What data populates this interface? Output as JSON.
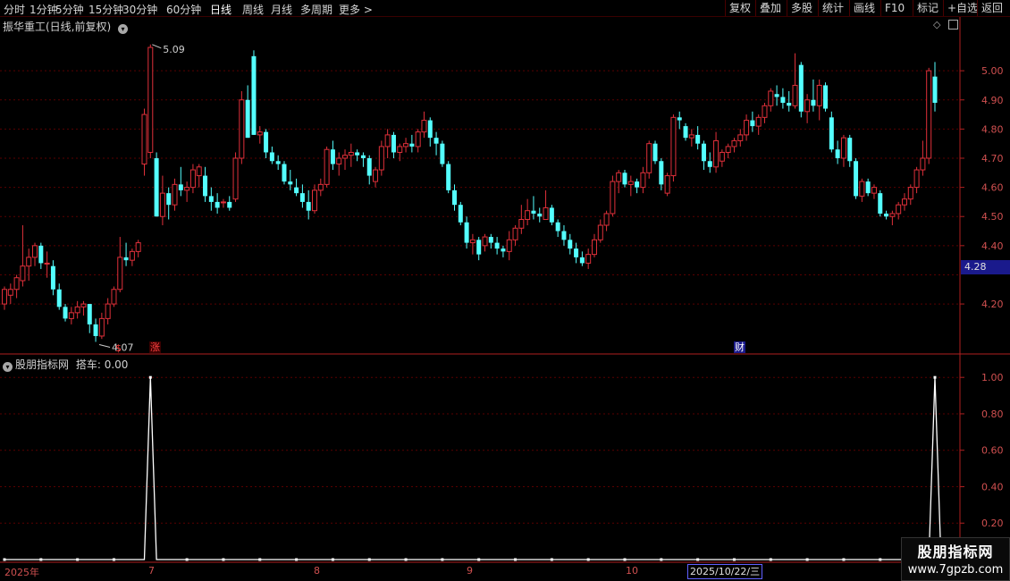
{
  "toolbar": {
    "periods": [
      "分时",
      "1分钟",
      "5分钟",
      "15分钟",
      "30分钟",
      "60分钟",
      "日线",
      "周线",
      "月线",
      "多周期",
      "更多 >"
    ],
    "active": "日线",
    "right_buttons": [
      "复权",
      "叠加",
      "多股",
      "统计",
      "画线",
      "F10",
      "标记",
      "+自选",
      "返回"
    ]
  },
  "main_panel": {
    "title": "振华重工(日线,前复权)",
    "high_label": "5.09",
    "low_label": "4.07",
    "current_price": "4.28",
    "yaxis_ticks": [
      "5.00",
      "4.90",
      "4.80",
      "4.70",
      "4.60",
      "4.50",
      "4.40",
      "4.20"
    ],
    "markers": [
      {
        "text": "$",
        "color": "#ff4040"
      },
      {
        "text": "涨",
        "color": "#ff4040"
      },
      {
        "text": "财",
        "color": "#ffffff"
      }
    ]
  },
  "indicator_panel": {
    "title": "股朋指标网",
    "value_label": "搭车: 0.00",
    "yaxis_ticks": [
      "1.00",
      "0.80",
      "0.60",
      "0.40",
      "0.20"
    ]
  },
  "time_axis": {
    "labels": [
      "2025年",
      "7",
      "8",
      "9",
      "10"
    ],
    "cursor_date": "2025/10/22/三"
  },
  "watermark": {
    "title": "股朋指标网",
    "url": "www.7gpzb.com"
  },
  "colors": {
    "up": "#e0303a",
    "down": "#54ffff",
    "grid": "#5a0000",
    "axis": "#b02020",
    "indicator_line": "#ffffff"
  },
  "chart_data": [
    {
      "type": "candlestick",
      "title": "振华重工(日线,前复权)",
      "ylim": [
        4.05,
        5.12
      ],
      "candles": [
        [
          4.2,
          4.26,
          4.18,
          4.25
        ],
        [
          4.23,
          4.27,
          4.2,
          4.25
        ],
        [
          4.25,
          4.3,
          4.22,
          4.29
        ],
        [
          4.28,
          4.47,
          4.26,
          4.33
        ],
        [
          4.33,
          4.39,
          4.28,
          4.36
        ],
        [
          4.36,
          4.41,
          4.33,
          4.4
        ],
        [
          4.4,
          4.41,
          4.32,
          4.34
        ],
        [
          4.34,
          4.38,
          4.29,
          4.34
        ],
        [
          4.33,
          4.35,
          4.23,
          4.25
        ],
        [
          4.25,
          4.27,
          4.18,
          4.19
        ],
        [
          4.19,
          4.2,
          4.14,
          4.15
        ],
        [
          4.15,
          4.19,
          4.13,
          4.17
        ],
        [
          4.17,
          4.21,
          4.15,
          4.19
        ],
        [
          4.19,
          4.21,
          4.16,
          4.2
        ],
        [
          4.2,
          4.2,
          4.1,
          4.13
        ],
        [
          4.13,
          4.15,
          4.07,
          4.09
        ],
        [
          4.09,
          4.17,
          4.08,
          4.15
        ],
        [
          4.15,
          4.22,
          4.13,
          4.2
        ],
        [
          4.2,
          4.26,
          4.19,
          4.25
        ],
        [
          4.25,
          4.43,
          4.24,
          4.36
        ],
        [
          4.36,
          4.41,
          4.33,
          4.35
        ],
        [
          4.35,
          4.39,
          4.33,
          4.38
        ],
        [
          4.38,
          4.42,
          4.36,
          4.41
        ],
        [
          4.68,
          4.87,
          4.64,
          4.85
        ],
        [
          4.72,
          5.09,
          4.7,
          5.08
        ],
        [
          4.7,
          4.72,
          4.5,
          4.5
        ],
        [
          4.5,
          4.64,
          4.47,
          4.58
        ],
        [
          4.58,
          4.6,
          4.49,
          4.54
        ],
        [
          4.54,
          4.63,
          4.52,
          4.61
        ],
        [
          4.61,
          4.67,
          4.57,
          4.59
        ],
        [
          4.59,
          4.62,
          4.55,
          4.6
        ],
        [
          4.6,
          4.68,
          4.58,
          4.66
        ],
        [
          4.64,
          4.68,
          4.6,
          4.67
        ],
        [
          4.64,
          4.67,
          4.55,
          4.57
        ],
        [
          4.57,
          4.6,
          4.52,
          4.55
        ],
        [
          4.55,
          4.58,
          4.51,
          4.53
        ],
        [
          4.55,
          4.56,
          4.53,
          4.55
        ],
        [
          4.55,
          4.57,
          4.52,
          4.53
        ],
        [
          4.56,
          4.72,
          4.55,
          4.7
        ],
        [
          4.7,
          4.93,
          4.68,
          4.9
        ],
        [
          4.9,
          4.95,
          4.77,
          4.77
        ],
        [
          5.05,
          5.07,
          4.78,
          4.78
        ],
        [
          4.78,
          4.81,
          4.75,
          4.79
        ],
        [
          4.79,
          4.8,
          4.7,
          4.72
        ],
        [
          4.72,
          4.74,
          4.68,
          4.69
        ],
        [
          4.69,
          4.71,
          4.66,
          4.68
        ],
        [
          4.68,
          4.69,
          4.61,
          4.62
        ],
        [
          4.62,
          4.66,
          4.59,
          4.61
        ],
        [
          4.6,
          4.63,
          4.57,
          4.58
        ],
        [
          4.58,
          4.61,
          4.53,
          4.55
        ],
        [
          4.55,
          4.59,
          4.49,
          4.52
        ],
        [
          4.52,
          4.61,
          4.51,
          4.59
        ],
        [
          4.59,
          4.63,
          4.57,
          4.61
        ],
        [
          4.61,
          4.74,
          4.6,
          4.73
        ],
        [
          4.73,
          4.76,
          4.66,
          4.68
        ],
        [
          4.68,
          4.72,
          4.64,
          4.7
        ],
        [
          4.7,
          4.73,
          4.66,
          4.71
        ],
        [
          4.71,
          4.75,
          4.67,
          4.72
        ],
        [
          4.72,
          4.73,
          4.69,
          4.71
        ],
        [
          4.71,
          4.72,
          4.67,
          4.7
        ],
        [
          4.7,
          4.71,
          4.61,
          4.64
        ],
        [
          4.62,
          4.67,
          4.6,
          4.66
        ],
        [
          4.66,
          4.76,
          4.64,
          4.74
        ],
        [
          4.74,
          4.8,
          4.7,
          4.78
        ],
        [
          4.78,
          4.79,
          4.7,
          4.72
        ],
        [
          4.72,
          4.75,
          4.69,
          4.74
        ],
        [
          4.74,
          4.77,
          4.72,
          4.75
        ],
        [
          4.75,
          4.78,
          4.72,
          4.74
        ],
        [
          4.74,
          4.8,
          4.72,
          4.79
        ],
        [
          4.79,
          4.86,
          4.77,
          4.83
        ],
        [
          4.83,
          4.84,
          4.74,
          4.77
        ],
        [
          4.77,
          4.79,
          4.71,
          4.75
        ],
        [
          4.75,
          4.76,
          4.67,
          4.68
        ],
        [
          4.68,
          4.69,
          4.58,
          4.59
        ],
        [
          4.59,
          4.61,
          4.52,
          4.54
        ],
        [
          4.54,
          4.55,
          4.47,
          4.48
        ],
        [
          4.48,
          4.5,
          4.39,
          4.41
        ],
        [
          4.41,
          4.44,
          4.37,
          4.42
        ],
        [
          4.42,
          4.43,
          4.35,
          4.37
        ],
        [
          4.4,
          4.44,
          4.38,
          4.43
        ],
        [
          4.43,
          4.44,
          4.39,
          4.41
        ],
        [
          4.41,
          4.43,
          4.37,
          4.39
        ],
        [
          4.39,
          4.4,
          4.36,
          4.38
        ],
        [
          4.38,
          4.45,
          4.35,
          4.42
        ],
        [
          4.42,
          4.47,
          4.4,
          4.46
        ],
        [
          4.46,
          4.54,
          4.44,
          4.49
        ],
        [
          4.49,
          4.56,
          4.47,
          4.52
        ],
        [
          4.52,
          4.57,
          4.49,
          4.51
        ],
        [
          4.51,
          4.53,
          4.48,
          4.5
        ],
        [
          4.49,
          4.59,
          4.49,
          4.53
        ],
        [
          4.53,
          4.54,
          4.47,
          4.48
        ],
        [
          4.48,
          4.49,
          4.43,
          4.45
        ],
        [
          4.45,
          4.47,
          4.4,
          4.42
        ],
        [
          4.42,
          4.44,
          4.37,
          4.39
        ],
        [
          4.39,
          4.41,
          4.34,
          4.36
        ],
        [
          4.36,
          4.38,
          4.33,
          4.34
        ],
        [
          4.34,
          4.39,
          4.32,
          4.37
        ],
        [
          4.37,
          4.44,
          4.36,
          4.42
        ],
        [
          4.42,
          4.49,
          4.41,
          4.47
        ],
        [
          4.47,
          4.52,
          4.45,
          4.51
        ],
        [
          4.51,
          4.64,
          4.5,
          4.62
        ],
        [
          4.62,
          4.66,
          4.58,
          4.65
        ],
        [
          4.65,
          4.66,
          4.6,
          4.61
        ],
        [
          4.61,
          4.64,
          4.57,
          4.62
        ],
        [
          4.62,
          4.63,
          4.58,
          4.6
        ],
        [
          4.6,
          4.67,
          4.58,
          4.65
        ],
        [
          4.65,
          4.76,
          4.63,
          4.75
        ],
        [
          4.75,
          4.76,
          4.68,
          4.69
        ],
        [
          4.69,
          4.7,
          4.59,
          4.61
        ],
        [
          4.58,
          4.65,
          4.57,
          4.64
        ],
        [
          4.64,
          4.85,
          4.62,
          4.84
        ],
        [
          4.84,
          4.86,
          4.8,
          4.83
        ],
        [
          4.81,
          4.82,
          4.76,
          4.77
        ],
        [
          4.77,
          4.8,
          4.74,
          4.78
        ],
        [
          4.78,
          4.81,
          4.73,
          4.75
        ],
        [
          4.75,
          4.76,
          4.66,
          4.69
        ],
        [
          4.69,
          4.72,
          4.65,
          4.67
        ],
        [
          4.67,
          4.79,
          4.65,
          4.76
        ],
        [
          4.69,
          4.73,
          4.67,
          4.72
        ],
        [
          4.72,
          4.75,
          4.7,
          4.74
        ],
        [
          4.74,
          4.77,
          4.72,
          4.76
        ],
        [
          4.76,
          4.8,
          4.74,
          4.78
        ],
        [
          4.78,
          4.85,
          4.76,
          4.83
        ],
        [
          4.83,
          4.86,
          4.79,
          4.81
        ],
        [
          4.81,
          4.85,
          4.78,
          4.84
        ],
        [
          4.84,
          4.89,
          4.82,
          4.88
        ],
        [
          4.88,
          4.94,
          4.86,
          4.93
        ],
        [
          4.92,
          4.95,
          4.88,
          4.91
        ],
        [
          4.91,
          4.94,
          4.87,
          4.89
        ],
        [
          4.89,
          4.93,
          4.86,
          4.88
        ],
        [
          4.88,
          5.06,
          4.87,
          4.95
        ],
        [
          5.02,
          5.03,
          4.84,
          4.86
        ],
        [
          4.86,
          4.92,
          4.82,
          4.9
        ],
        [
          4.9,
          4.97,
          4.86,
          4.88
        ],
        [
          4.88,
          4.97,
          4.83,
          4.95
        ],
        [
          4.95,
          4.96,
          4.86,
          4.87
        ],
        [
          4.84,
          4.86,
          4.72,
          4.73
        ],
        [
          4.73,
          4.76,
          4.68,
          4.7
        ],
        [
          4.7,
          4.78,
          4.67,
          4.77
        ],
        [
          4.77,
          4.78,
          4.67,
          4.69
        ],
        [
          4.69,
          4.7,
          4.56,
          4.57
        ],
        [
          4.57,
          4.63,
          4.55,
          4.62
        ],
        [
          4.62,
          4.63,
          4.57,
          4.58
        ],
        [
          4.58,
          4.61,
          4.56,
          4.6
        ],
        [
          4.58,
          4.59,
          4.5,
          4.51
        ],
        [
          4.51,
          4.52,
          4.49,
          4.5
        ],
        [
          4.5,
          4.52,
          4.47,
          4.51
        ],
        [
          4.51,
          4.55,
          4.49,
          4.54
        ],
        [
          4.54,
          4.58,
          4.52,
          4.56
        ],
        [
          4.56,
          4.61,
          4.54,
          4.6
        ],
        [
          4.6,
          4.67,
          4.58,
          4.66
        ],
        [
          4.66,
          4.76,
          4.64,
          4.7
        ],
        [
          4.7,
          5.01,
          4.68,
          5.0
        ],
        [
          4.98,
          5.03,
          4.86,
          4.89
        ]
      ]
    },
    {
      "type": "line",
      "title": "搭车",
      "ylim": [
        0,
        1.05
      ],
      "series": [
        {
          "values": [
            0,
            0,
            0,
            0,
            0,
            0,
            0,
            0,
            0,
            0,
            0,
            0,
            0,
            0,
            0,
            0,
            0,
            0,
            0,
            0,
            0,
            0,
            0,
            0,
            1,
            0,
            0,
            0,
            0,
            0,
            0,
            0,
            0,
            0,
            0,
            0,
            0,
            0,
            0,
            0,
            0,
            0,
            0,
            0,
            0,
            0,
            0,
            0,
            0,
            0,
            0,
            0,
            0,
            0,
            0,
            0,
            0,
            0,
            0,
            0,
            0,
            0,
            0,
            0,
            0,
            0,
            0,
            0,
            0,
            0,
            0,
            0,
            0,
            0,
            0,
            0,
            0,
            0,
            0,
            0,
            0,
            0,
            0,
            0,
            0,
            0,
            0,
            0,
            0,
            0,
            0,
            0,
            0,
            0,
            0,
            0,
            0,
            0,
            0,
            0,
            0,
            0,
            0,
            0,
            0,
            0,
            0,
            0,
            0,
            0,
            0,
            0,
            0,
            0,
            0,
            0,
            0,
            0,
            0,
            0,
            0,
            0,
            0,
            0,
            0,
            0,
            0,
            0,
            0,
            0,
            0,
            0,
            0,
            0,
            0,
            0,
            0,
            0,
            0,
            0,
            0,
            0,
            0,
            0,
            0,
            0,
            0,
            0,
            0,
            0,
            0,
            0,
            0,
            1,
            0
          ]
        }
      ]
    }
  ]
}
